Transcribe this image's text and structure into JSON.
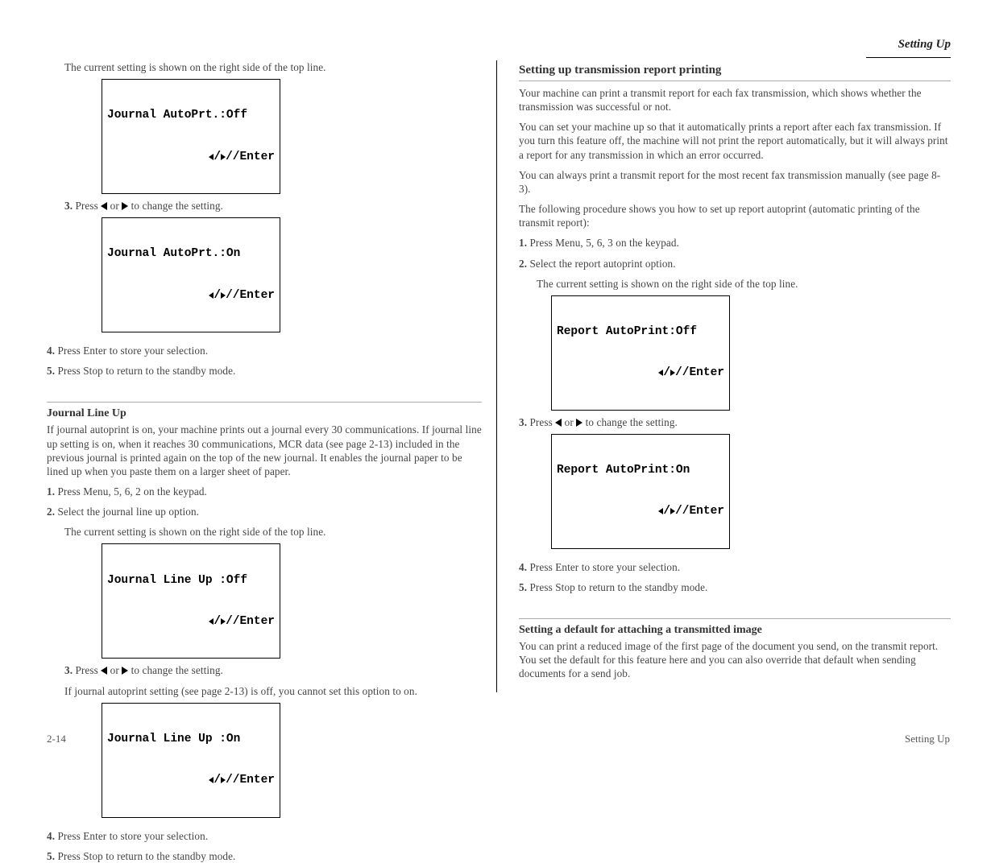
{
  "header": {
    "label": "Setting Up",
    "rule": true
  },
  "page_number_left": "2-14",
  "page_number_right": "Setting Up",
  "left": {
    "intro": "The current setting is shown on the right side of the top line.",
    "lcd1": {
      "line1": "Journal AutoPrt.:Off",
      "line2_suffix": "/Enter"
    },
    "step3a": "Press ",
    "step3b": " or ",
    "step3c": " to change the setting.",
    "lcd2": {
      "line1": "Journal AutoPrt.:On",
      "line2_suffix": "/Enter"
    },
    "step4": {
      "num": "4.",
      "text": "Press Enter to store your selection."
    },
    "step5": {
      "num": "5.",
      "text": "Press Stop to return to the standby mode."
    },
    "lu_title": "Journal Line Up",
    "lu_para": "If journal autoprint is on, your machine prints out a journal every 30 communications. If journal line up setting is on, when it reaches 30 communications, MCR data (see page 2-13) included in the previous journal is printed again on the top of the new journal. It enables the journal paper to be lined up when you paste them on a larger sheet of paper.",
    "lu_s1": {
      "num": "1.",
      "text": "Press Menu, 5, 6, 2 on the keypad."
    },
    "lu_s2": {
      "num": "2.",
      "text": "Select the journal line up option."
    },
    "lu_intro": "The current setting is shown on the right side of the top line.",
    "lcd3": {
      "line1": "Journal Line Up :Off",
      "line2_suffix": "/Enter"
    },
    "lu_s3a": "Press ",
    "lu_s3b": " or ",
    "lu_s3c": " to change the setting.",
    "lu_note": "If journal autoprint setting (see page 2-13) is off, you cannot set this option to on.",
    "lcd4": {
      "line1": "Journal Line Up :On",
      "line2_suffix": "/Enter"
    },
    "lu_s4": {
      "num": "4.",
      "text": "Press Enter to store your selection."
    },
    "lu_s5": {
      "num": "5.",
      "text": "Press Stop to return to the standby mode."
    }
  },
  "right": {
    "rpt_head": "Setting up transmission report printing",
    "rpt_para1": "Your machine can print a transmit report for each fax transmission, which shows whether the transmission was successful or not.",
    "rpt_para2": "You can set your machine up so that it automatically prints a report after each fax transmission. If you turn this feature off, the machine will not print the report automatically, but it will always print a report for any transmission in which an error occurred.",
    "rpt_para3": "You can always print a transmit report for the most recent fax transmission manually (see page 8-3).",
    "rpt_para4": "The following procedure shows you how to set up report autoprint (automatic printing of the transmit report):",
    "rpt_s1": {
      "num": "1.",
      "text": "Press Menu, 5, 6, 3 on the keypad."
    },
    "rpt_s2": {
      "num": "2.",
      "text": "Select the report autoprint option."
    },
    "rpt_intro": "The current setting is shown on the right side of the top line.",
    "lcd5": {
      "line1": "Report AutoPrint:Off",
      "line2_suffix": "/Enter"
    },
    "rpt_s3a": "Press ",
    "rpt_s3b": " or ",
    "rpt_s3c": " to change the setting.",
    "lcd6": {
      "line1": "Report AutoPrint:On",
      "line2_suffix": "/Enter"
    },
    "rpt_s4": {
      "num": "4.",
      "text": "Press Enter to store your selection."
    },
    "rpt_s5": {
      "num": "5.",
      "text": "Press Stop to return to the standby mode."
    },
    "note_head": "Setting a default for attaching a transmitted image",
    "note_para": "You can print a reduced image of the first page of the document you send, on the transmit report. You set the default for this feature here and you can also override that default when sending documents for a send job."
  }
}
